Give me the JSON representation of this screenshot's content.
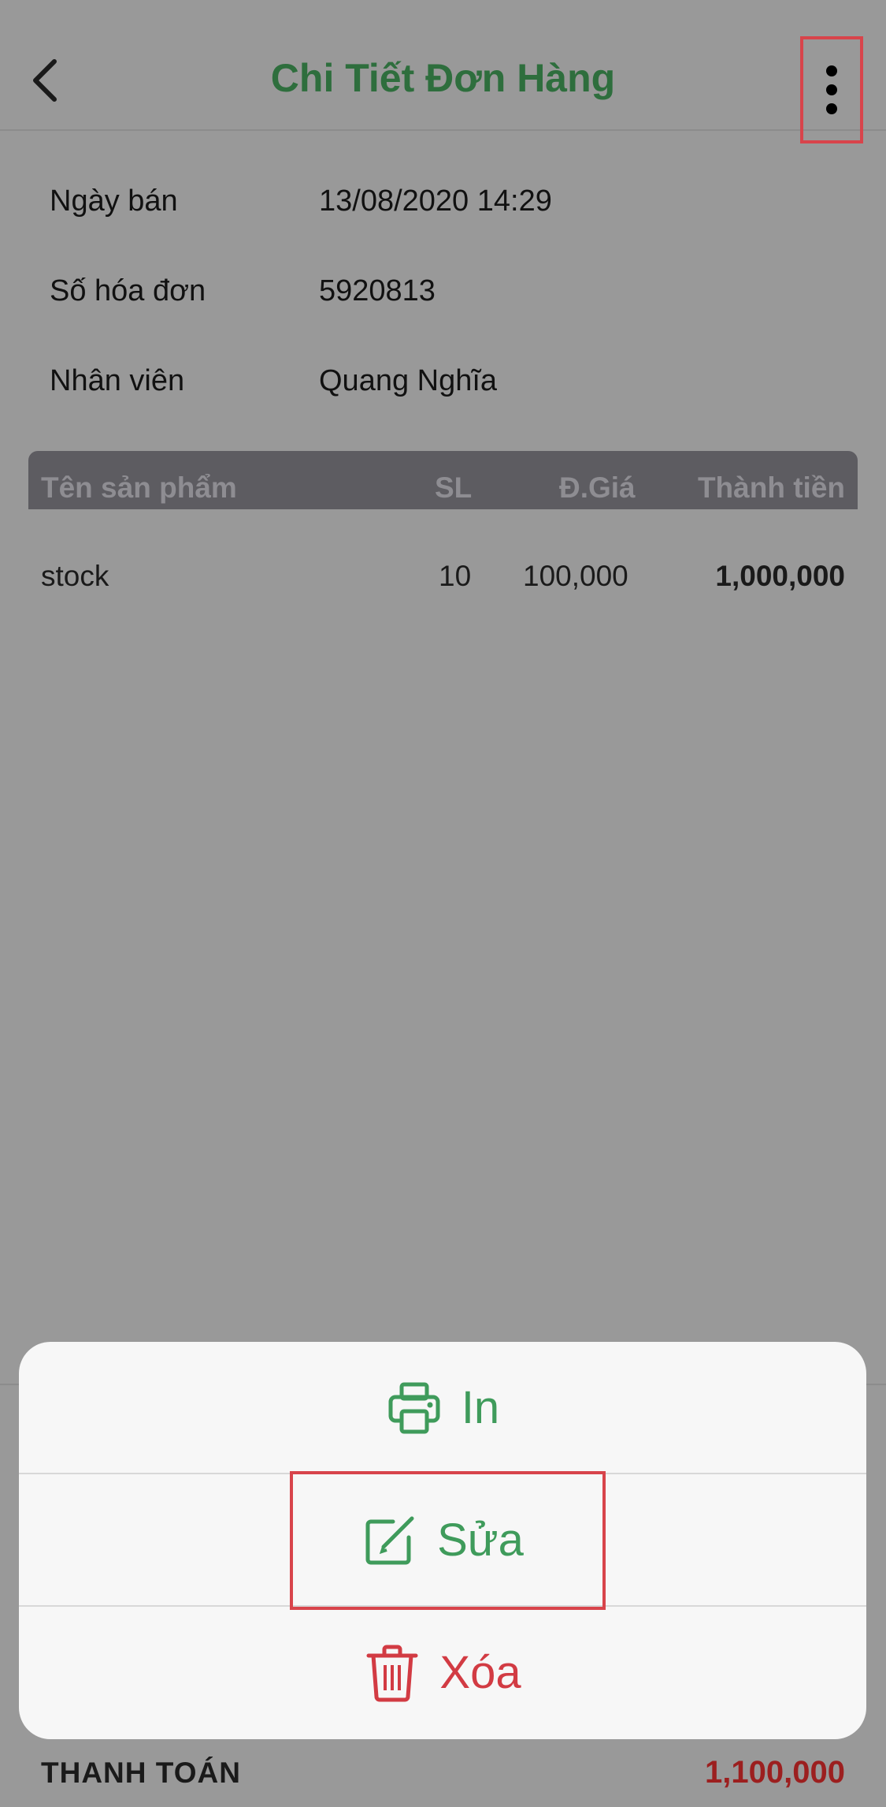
{
  "header": {
    "title": "Chi Tiết Đơn Hàng",
    "back_icon": "chevron-left-icon",
    "more_icon": "vertical-dots-icon"
  },
  "info": {
    "sale_date_label": "Ngày bán",
    "sale_date_value": "13/08/2020 14:29",
    "invoice_label": "Số hóa đơn",
    "invoice_value": "5920813",
    "staff_label": "Nhân viên",
    "staff_value": "Quang Nghĩa"
  },
  "table": {
    "headers": {
      "product": "Tên sản phẩm",
      "qty": "SL",
      "price": "Đ.Giá",
      "total": "Thành tiền"
    },
    "rows": [
      {
        "product": "stock",
        "qty": "10",
        "price": "100,000",
        "total": "1,000,000"
      }
    ]
  },
  "payment": {
    "label": "THANH TOÁN",
    "total": "1,100,000"
  },
  "action_sheet": {
    "print_label": "In",
    "edit_label": "Sửa",
    "delete_label": "Xóa",
    "print_icon": "printer-icon",
    "edit_icon": "edit-icon",
    "delete_icon": "trash-icon"
  },
  "colors": {
    "title_green": "#2e6e3d",
    "action_green": "#3f9b5b",
    "delete_red": "#d23b43",
    "total_red": "#9c1f1f",
    "highlight_red": "#d8444b"
  }
}
